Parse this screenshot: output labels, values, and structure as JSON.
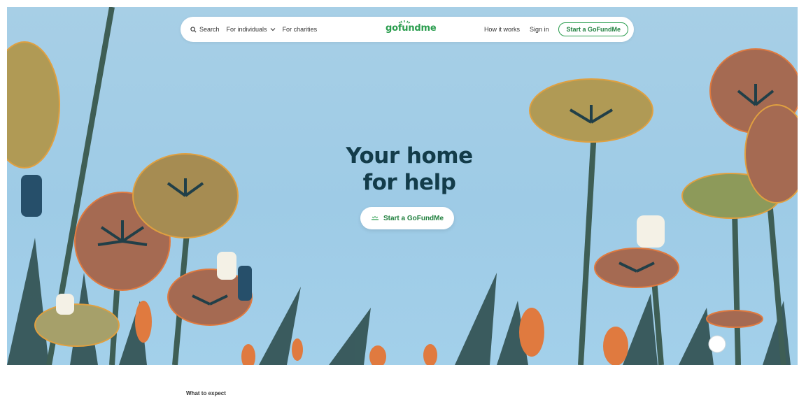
{
  "nav": {
    "search_label": "Search",
    "individuals_label": "For individuals",
    "charities_label": "For charities",
    "logo_text": "gofundme",
    "how_it_works": "How it works",
    "sign_in": "Sign in",
    "start_button": "Start a GoFundMe"
  },
  "hero": {
    "headline_line1": "Your home",
    "headline_line2": "for help",
    "cta_label": "Start a GoFundMe"
  },
  "section": {
    "what_to_expect": "What to expect"
  },
  "colors": {
    "brand_green": "#2a9d4e",
    "headline_navy": "#133c4a",
    "sky": "#a7cfe6"
  }
}
